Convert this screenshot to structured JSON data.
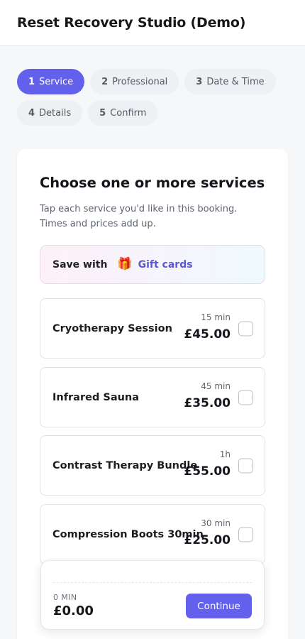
{
  "header": {
    "title": "Reset Recovery Studio (Demo)"
  },
  "steps": [
    {
      "num": "1",
      "label": "Service",
      "active": true
    },
    {
      "num": "2",
      "label": "Professional",
      "active": false
    },
    {
      "num": "3",
      "label": "Date & Time",
      "active": false
    },
    {
      "num": "4",
      "label": "Details",
      "active": false
    },
    {
      "num": "5",
      "label": "Confirm",
      "active": false
    }
  ],
  "section": {
    "title": "Choose one or more services",
    "description": "Tap each service you'd like in this booking. Times and prices add up."
  },
  "gift_banner": {
    "text": "Save with",
    "icon": "gift-icon",
    "link_label": "Gift cards"
  },
  "services": [
    {
      "name": "Cryotherapy Session",
      "duration": "15 min",
      "price": "£45.00",
      "selected": false
    },
    {
      "name": "Infrared Sauna",
      "duration": "45 min",
      "price": "£35.00",
      "selected": false
    },
    {
      "name": "Contrast Therapy Bundle",
      "duration": "1h",
      "price": "£55.00",
      "selected": false
    },
    {
      "name": "Compression Boots 30min",
      "duration": "30 min",
      "price": "£25.00",
      "selected": false
    }
  ],
  "summary": {
    "duration": "0 MIN",
    "total": "£0.00",
    "continue_label": "Continue"
  },
  "colors": {
    "accent": "#6360eb",
    "link": "#5b57d6",
    "page_background": "#f6f7f9"
  }
}
